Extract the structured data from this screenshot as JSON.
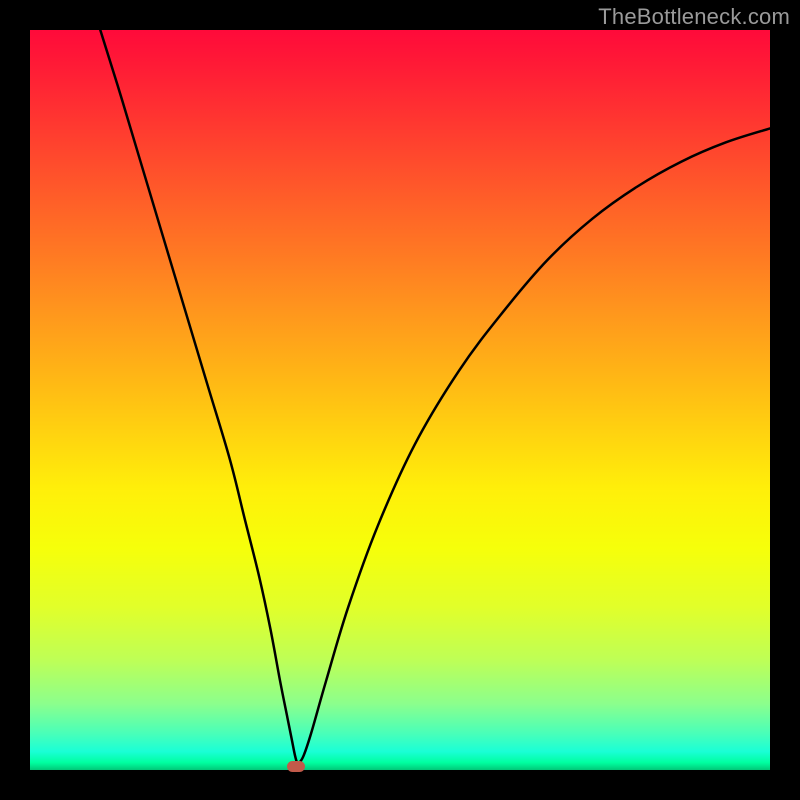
{
  "watermark": "TheBottleneck.com",
  "chart_data": {
    "type": "line",
    "title": "",
    "xlabel": "",
    "ylabel": "",
    "xlim": [
      0,
      100
    ],
    "ylim": [
      0,
      100
    ],
    "series": [
      {
        "name": "curve",
        "x": [
          9.5,
          12,
          15,
          18,
          21,
          24,
          27,
          29,
          31,
          32.5,
          33.8,
          34.8,
          35.4,
          35.8,
          36.1,
          36.4,
          37.0,
          38.0,
          40.0,
          43.0,
          47.0,
          52.0,
          58.0,
          64.0,
          70.0,
          76.0,
          82.0,
          88.0,
          94.0,
          100.0
        ],
        "y": [
          100,
          92,
          82,
          72,
          62,
          52,
          42,
          34,
          26,
          19,
          12,
          7,
          4,
          2,
          1,
          1,
          2,
          5,
          12,
          22,
          33,
          44,
          54,
          62,
          69,
          74.5,
          78.8,
          82.2,
          84.8,
          86.7
        ]
      }
    ],
    "marker": {
      "x": 36.0,
      "y": 0.5
    },
    "colors": {
      "curve": "#000000",
      "marker": "#c15a4a",
      "gradient_top": "#ff0a3a",
      "gradient_bottom": "#00c878"
    }
  }
}
